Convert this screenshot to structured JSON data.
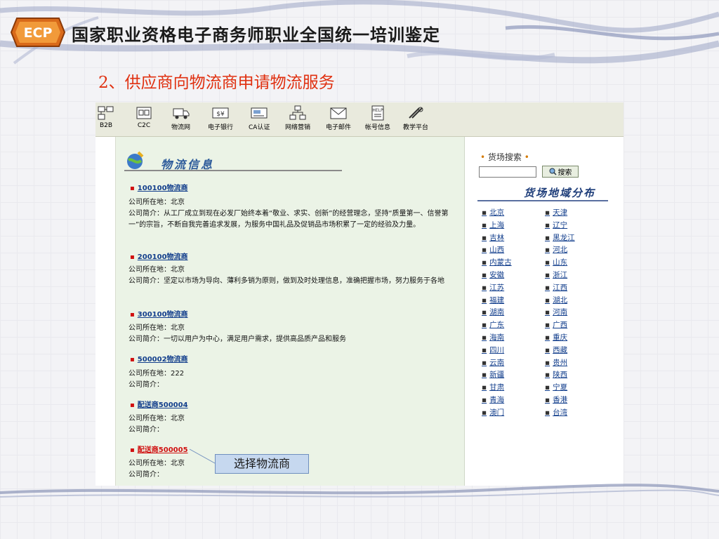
{
  "slide": {
    "header_title": "国家职业资格电子商务师职业全国统一培训鉴定",
    "logo_text": "ECP",
    "title": "2、供应商向物流商申请物流服务"
  },
  "toolbar": {
    "items": [
      {
        "label": "B2B",
        "icon": "network-icon"
      },
      {
        "label": "C2C",
        "icon": "c2c-icon"
      },
      {
        "label": "物流网",
        "icon": "truck-icon"
      },
      {
        "label": "电子银行",
        "icon": "money-icon"
      },
      {
        "label": "CA认证",
        "icon": "certificate-icon"
      },
      {
        "label": "网络营销",
        "icon": "marketing-icon"
      },
      {
        "label": "电子邮件",
        "icon": "mail-icon"
      },
      {
        "label": "帐号信息",
        "icon": "help-icon"
      },
      {
        "label": "教学平台",
        "icon": "tools-icon"
      }
    ]
  },
  "main": {
    "section_title": "物流信息",
    "providers": [
      {
        "name": "100100物流商",
        "location": "公司所在地：北京",
        "intro": "公司简介：从工厂成立到现在必发厂始终本着“敬业、求实、创新”的经营理念，坚持“质量第一、信誉第一”的宗旨，不断自我完善追求发展，为服务中国礼品及促销品市场积累了一定的经验及力量。"
      },
      {
        "name": "200100物流商",
        "location": "公司所在地：北京",
        "intro": "公司简介：坚定以市场为导向、薄利多销为原则，做到及时处理信息，准确把握市场，努力服务于各地"
      },
      {
        "name": "300100物流商",
        "location": "公司所在地：北京",
        "intro": "公司简介：一切以用户为中心，满足用户需求，提供高品质产品和服务"
      },
      {
        "name": "500002物流商",
        "location": "公司所在地：222",
        "intro": "公司简介："
      },
      {
        "name": "配送商500004",
        "location": "公司所在地：北京",
        "intro": "公司简介："
      },
      {
        "name": "配送商500005",
        "location": "公司所在地：北京",
        "intro": "公司简介："
      }
    ]
  },
  "sidebar": {
    "search_title": "货场搜索",
    "search_placeholder": "",
    "search_button": "搜索",
    "region_title": "货场地域分布",
    "regions": [
      "北京",
      "天津",
      "上海",
      "辽宁",
      "吉林",
      "黑龙江",
      "山西",
      "河北",
      "内蒙古",
      "山东",
      "安徽",
      "浙江",
      "江苏",
      "江西",
      "福建",
      "湖北",
      "湖南",
      "河南",
      "广东",
      "广西",
      "海南",
      "重庆",
      "四川",
      "西藏",
      "云南",
      "贵州",
      "新疆",
      "陕西",
      "甘肃",
      "宁夏",
      "青海",
      "香港",
      "澳门",
      "台湾"
    ]
  },
  "callout": {
    "text": "选择物流商"
  },
  "colors": {
    "title_red": "#e03010",
    "link_blue": "#123e8c",
    "panel_green": "#ebf3e6",
    "callout_blue": "#c6d8ef"
  }
}
